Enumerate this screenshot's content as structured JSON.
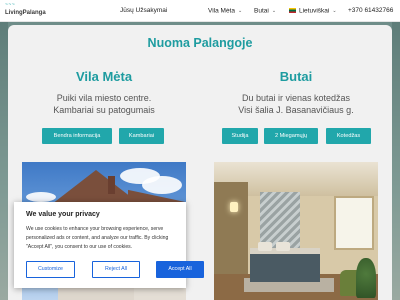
{
  "header": {
    "logo_mark": "~~~",
    "logo_text": "LivingPalanga",
    "nav": [
      {
        "label": "Jūsų Užsakymai",
        "has_dropdown": false
      },
      {
        "label": "Vila Mėta",
        "has_dropdown": true
      },
      {
        "label": "Butai",
        "has_dropdown": true
      },
      {
        "label": "Lietuviškai",
        "has_dropdown": true,
        "icon": "lithuania-flag-icon"
      },
      {
        "label": "+370 61432766",
        "has_dropdown": false
      }
    ],
    "chevron": "⌄"
  },
  "main": {
    "page_title": "Nuoma Palangoje",
    "left": {
      "title": "Vila Mėta",
      "desc_line1": "Puiki vila miesto centre.",
      "desc_line2": "Kambariai su patogumais",
      "buttons": [
        "Bendra informacija",
        "Kambariai"
      ]
    },
    "right": {
      "title": "Butai",
      "desc_line1": "Du butai ir vienas kotedžas",
      "desc_line2": "Visi šalia J. Basanavičiaus g.",
      "buttons": [
        "Studija",
        "2 Miegamųjų",
        "Kotedžas"
      ]
    }
  },
  "cookie": {
    "title": "We value your privacy",
    "text": "We use cookies to enhance your browsing experience, serve personalized ads or content, and analyze our traffic. By clicking \"Accept All\", you consent to our use of cookies.",
    "buttons": {
      "customize": "Customize",
      "reject": "Reject All",
      "accept": "Accept All"
    }
  },
  "colors": {
    "accent": "#21a7ab",
    "title": "#1e9ca0",
    "cookie_button": "#1863dc"
  }
}
